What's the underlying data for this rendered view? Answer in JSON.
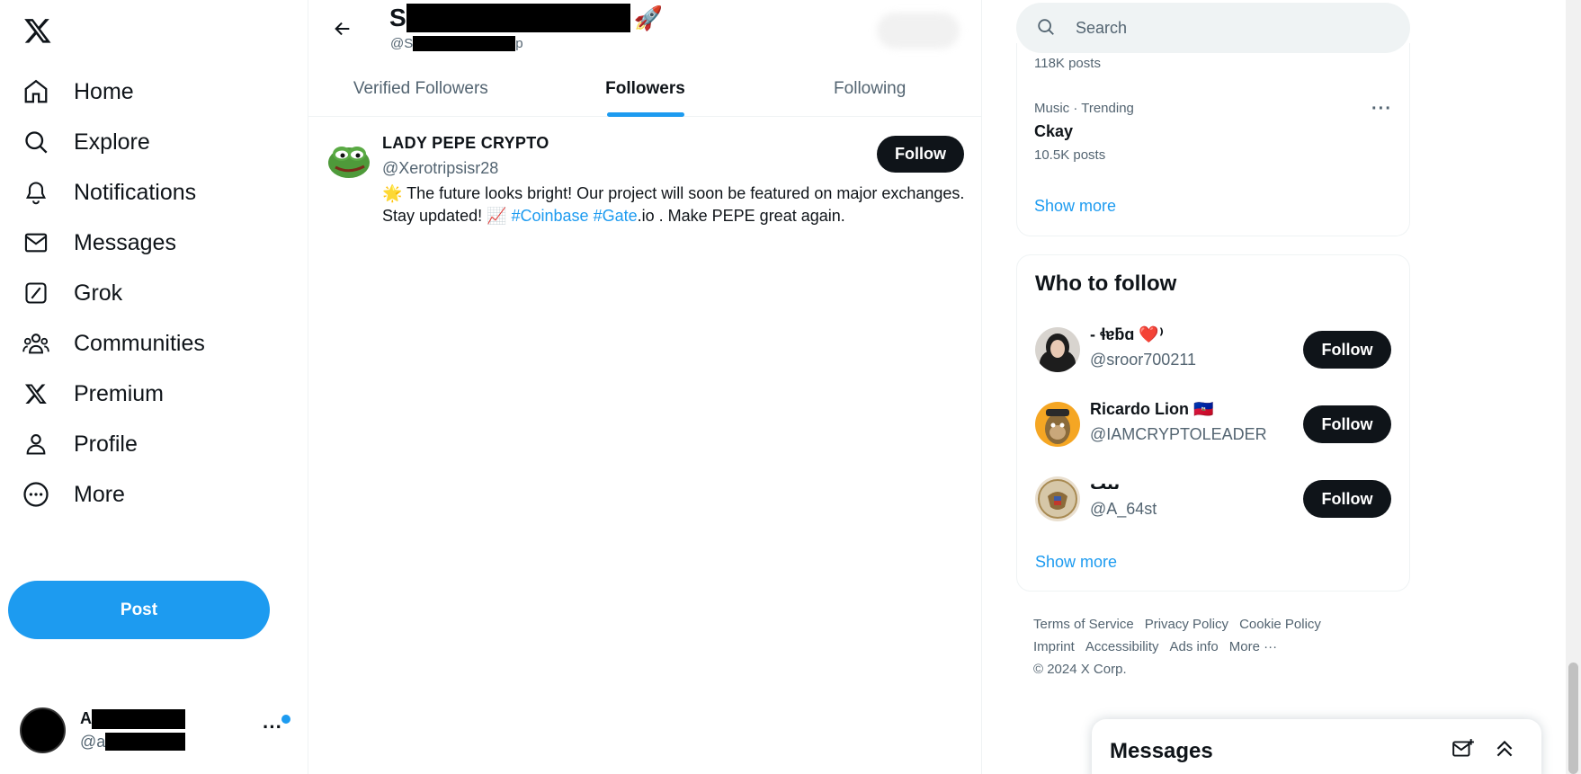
{
  "nav": {
    "logo": "x-logo",
    "items": [
      {
        "label": "Home",
        "icon": "home-icon"
      },
      {
        "label": "Explore",
        "icon": "search-icon"
      },
      {
        "label": "Notifications",
        "icon": "bell-icon"
      },
      {
        "label": "Messages",
        "icon": "envelope-icon"
      },
      {
        "label": "Grok",
        "icon": "grok-icon"
      },
      {
        "label": "Communities",
        "icon": "people-icon"
      },
      {
        "label": "Premium",
        "icon": "x-icon"
      },
      {
        "label": "Profile",
        "icon": "person-icon"
      },
      {
        "label": "More",
        "icon": "more-circle-icon"
      }
    ],
    "post_label": "Post",
    "account": {
      "name_initial": "A",
      "handle_prefix": "@a",
      "more": "···"
    }
  },
  "header": {
    "title_initial": "S",
    "title_emoji": "🚀",
    "handle_prefix": "@S",
    "handle_suffix": "p",
    "tabs": [
      {
        "label": "Verified Followers",
        "active": false
      },
      {
        "label": "Followers",
        "active": true
      },
      {
        "label": "Following",
        "active": false
      }
    ]
  },
  "followers": [
    {
      "name": "LADY PEPE CRYPTO",
      "handle": "@Xerotripsisr28",
      "bio_prefix": "🌟 The future looks bright! Our project will soon be featured on major exchanges. Stay updated! 📈 ",
      "tag1": "#Coinbase",
      "tag2": "#Gate",
      "bio_suffix": ".io . Make PEPE great again.",
      "follow_label": "Follow"
    }
  ],
  "search": {
    "placeholder": "Search"
  },
  "trends": {
    "first_count": "118K posts",
    "item": {
      "meta": "Music · Trending",
      "name": "Ckay",
      "count": "10.5K posts"
    },
    "more_dots": "···",
    "show_more": "Show more"
  },
  "who_to_follow": {
    "title": "Who to follow",
    "users": [
      {
        "name": "- ɬɐƃɑ ❤️⁾",
        "handle": "@sroor700211",
        "follow_label": "Follow"
      },
      {
        "name": "Ricardo Lion 🇭🇹",
        "handle": "@IAMCRYPTOLEADER",
        "follow_label": "Follow"
      },
      {
        "name": "ٮٮٮ",
        "handle": "@A_64st",
        "follow_label": "Follow"
      }
    ],
    "show_more": "Show more"
  },
  "footer": {
    "links": [
      "Terms of Service",
      "Privacy Policy",
      "Cookie Policy",
      "Imprint",
      "Accessibility",
      "Ads info",
      "More ···"
    ],
    "copyright": "© 2024 X Corp."
  },
  "messages_drawer": {
    "title": "Messages"
  },
  "colors": {
    "accent": "#1d9bf0",
    "text": "#0f1419",
    "muted": "#536471"
  }
}
